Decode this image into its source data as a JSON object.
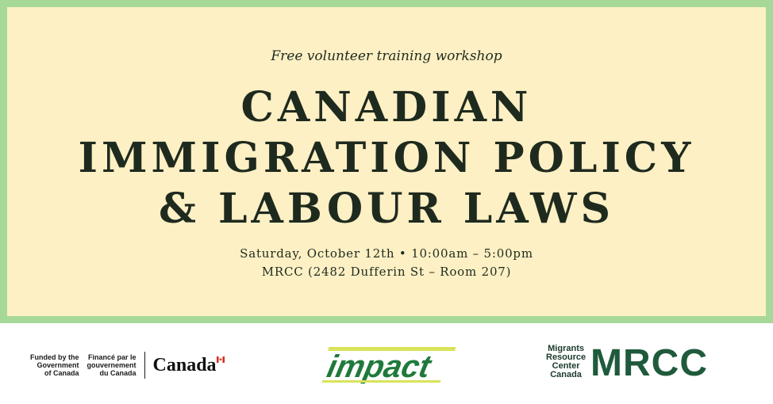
{
  "header": {
    "subtitle": "Free volunteer training workshop",
    "title_line1": "CANADIAN",
    "title_line2": "IMMIGRATION POLICY",
    "title_line3": "& LABOUR LAWS",
    "date_time": "Saturday, October 12th • 10:00am – 5:00pm",
    "location": "MRCC (2482 Dufferin St – Room 207)"
  },
  "footer": {
    "gov": {
      "en_line1": "Funded by the",
      "en_line2": "Government",
      "en_line3": "of Canada",
      "fr_line1": "Financé par le",
      "fr_line2": "gouvernement",
      "fr_line3": "du Canada",
      "wordmark": "Canada"
    },
    "impact_logo": "impact",
    "mrcc": {
      "line1": "Migrants",
      "line2": "Resource",
      "line3": "Center",
      "line4": "Canada",
      "acronym": "MRCC"
    }
  },
  "colors": {
    "background": "#fdf0c4",
    "border": "#a6d89a",
    "text": "#1f2a1f",
    "impact_green": "#1f7a3a",
    "impact_yellow": "#d9e35a",
    "mrcc_green": "#1f5a3c"
  }
}
